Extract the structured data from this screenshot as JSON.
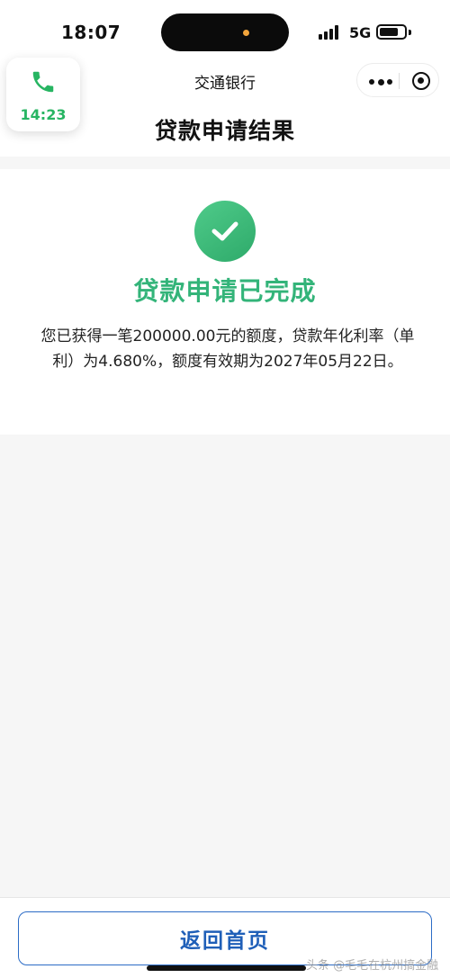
{
  "status_bar": {
    "time": "18:07",
    "network": "5G"
  },
  "header": {
    "bank_name": "交通银行",
    "page_title": "贷款申请结果"
  },
  "call_widget": {
    "duration": "14:23"
  },
  "result": {
    "heading": "贷款申请已完成",
    "message": "您已获得一笔200000.00元的额度，贷款年化利率（单利）为4.680%，额度有效期为2027年05月22日。"
  },
  "footer": {
    "home_button_label": "返回首页",
    "watermark": "头条 @毛毛在杭州搞金融"
  },
  "colors": {
    "success_green": "#33b479",
    "call_green": "#27b562",
    "button_blue": "#1f5fb8"
  }
}
